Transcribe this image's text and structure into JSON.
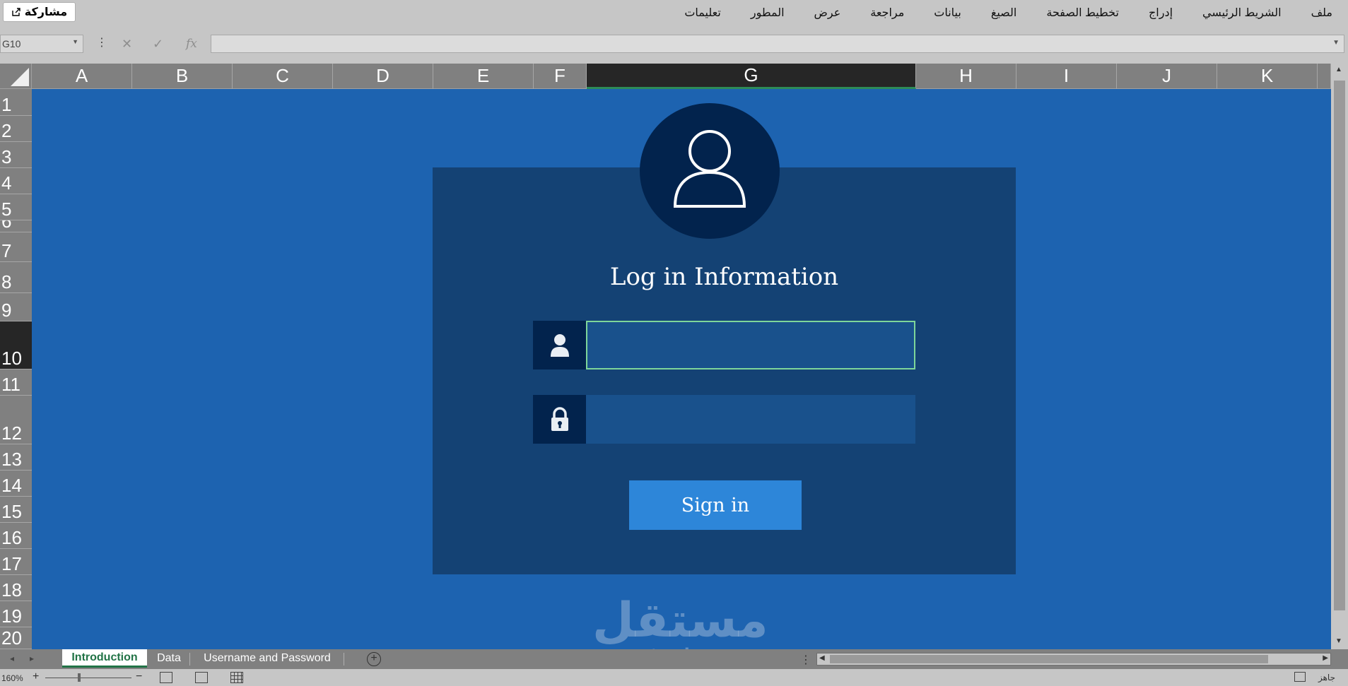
{
  "app": {
    "share_label": "مشاركة"
  },
  "ribbon": {
    "tabs": [
      "ملف",
      "الشريط الرئيسي",
      "إدراج",
      "تخطيط الصفحة",
      "الصيغ",
      "بيانات",
      "مراجعة",
      "عرض",
      "المطور",
      "تعليمات"
    ]
  },
  "formula_bar": {
    "name_box": "G10",
    "cancel_icon": "✕",
    "confirm_icon": "✓",
    "fx_label": "fx",
    "formula_value": ""
  },
  "grid": {
    "selected_column": "G",
    "selected_row": "10",
    "columns": [
      "A",
      "B",
      "C",
      "D",
      "E",
      "F",
      "G",
      "H",
      "I",
      "J",
      "K"
    ],
    "rows": [
      "1",
      "2",
      "3",
      "4",
      "5",
      "6",
      "7",
      "8",
      "9",
      "10",
      "11",
      "12",
      "13",
      "14",
      "15",
      "16",
      "17",
      "18",
      "19",
      "20"
    ]
  },
  "login": {
    "title": "Log in Information",
    "username_value": "",
    "password_value": "",
    "sign_in_label": "Sign in",
    "colors": {
      "sheet_background": "#1d63b0",
      "panel": "#144274",
      "icon_box": "#02234d",
      "input": "#19518c",
      "button": "#2d86d9"
    }
  },
  "watermark": {
    "logo_text": "مستقل",
    "url": "mostaql.com"
  },
  "sheets": {
    "tabs": [
      "Introduction",
      "Data",
      "Username and Password"
    ],
    "active": "Introduction"
  },
  "status": {
    "zoom": "160%",
    "ready": "جاهز"
  }
}
